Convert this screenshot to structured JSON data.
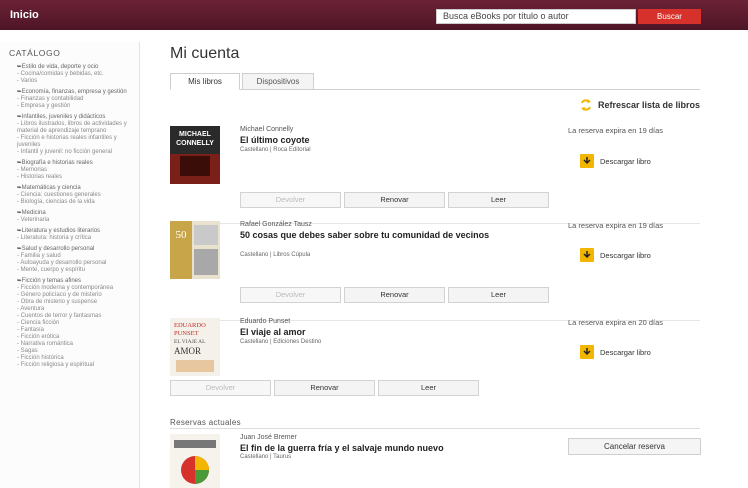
{
  "header": {
    "home_label": "Inicio",
    "search_placeholder": "Busca eBooks por título o autor",
    "search_button": "Buscar"
  },
  "sidebar": {
    "title": "CATÁLOGO",
    "groups": [
      {
        "head": "Estilo de vida, deporte y ocio",
        "items": [
          "Cocina/comidas y bebidas, etc.",
          "Varios"
        ]
      },
      {
        "head": "Economía, finanzas, empresa y gestión",
        "items": [
          "Finanzas y contabilidad",
          "Empresa y gestión"
        ]
      },
      {
        "head": "Infantiles, juveniles y didácticos",
        "items": [
          "Libros ilustrados, libros de actividades y material de aprendizaje temprano",
          "Ficción e historias reales infantiles y juveniles",
          "Infantil y juvenil: no ficción general"
        ]
      },
      {
        "head": "Biografía e historias reales",
        "items": [
          "Memorias",
          "Historias reales"
        ]
      },
      {
        "head": "Matemáticas y ciencia",
        "items": [
          "Ciencia: cuestiones generales",
          "Biología, ciencias de la vida"
        ]
      },
      {
        "head": "Medicina",
        "items": [
          "Veterinaria"
        ]
      },
      {
        "head": "Literatura y estudios literarios",
        "items": [
          "Literatura: historia y crítica"
        ]
      },
      {
        "head": "Salud y desarrollo personal",
        "items": [
          "Familia y salud",
          "Autoayuda y desarrollo personal",
          "Mente, cuerpo y espíritu"
        ]
      },
      {
        "head": "Ficción y temas afines",
        "items": [
          "Ficción moderna y contemporánea",
          "Género policíaco y de misterio",
          "Obra de misterio y suspense",
          "Aventura",
          "Cuentos de terror y fantasmas",
          "Ciencia ficción",
          "Fantasía",
          "Ficción erótica",
          "Narrativa romántica",
          "Sagas",
          "Ficción histórica",
          "Ficción religiosa y espiritual"
        ]
      }
    ]
  },
  "main": {
    "page_title": "Mi cuenta",
    "tabs": [
      {
        "label": "Mis libros"
      },
      {
        "label": "Dispositivos"
      }
    ],
    "refresh_label": "Refrescar lista de libros",
    "books": [
      {
        "author": "Michael Connelly",
        "title": "El último coyote",
        "meta": "Castellano | Roca Editorial",
        "expiry": "La reserva expira en 19 días",
        "download": "Descargar libro",
        "buttons": [
          "Devolver",
          "Renovar",
          "Leer"
        ]
      },
      {
        "author": "Rafael González Tausz",
        "title": "50 cosas que debes saber sobre tu comunidad de vecinos",
        "meta": "Castellano | Libros Cúpula",
        "expiry": "La reserva expira en 19 días",
        "download": "Descargar libro",
        "buttons": [
          "Devolver",
          "Renovar",
          "Leer"
        ]
      },
      {
        "author": "Eduardo Punset",
        "title": "El viaje al amor",
        "meta": "Castellano | Ediciones Destino",
        "expiry": "La reserva expira en 20 días",
        "download": "Descargar libro",
        "buttons": [
          "Devolver",
          "Renovar",
          "Leer"
        ]
      }
    ],
    "reservations_title": "Reservas actuales",
    "reservation": {
      "author": "Juan José Bremer",
      "title": "El fin de la guerra fría y el salvaje mundo nuevo",
      "meta": "Castellano | Taurus",
      "cancel": "Cancelar reserva"
    },
    "covers": {
      "cover1_text_top": "MICHAEL",
      "cover1_text_bottom": "CONNELLY",
      "cover2_number": "50",
      "cover3_lines": [
        "EDUARDO",
        "PUNSET",
        "EL VIAJE AL",
        "AMOR"
      ]
    }
  },
  "colors": {
    "header": "#5c1a2e",
    "search_button": "#d6322b",
    "download_icon": "#f2b600"
  }
}
